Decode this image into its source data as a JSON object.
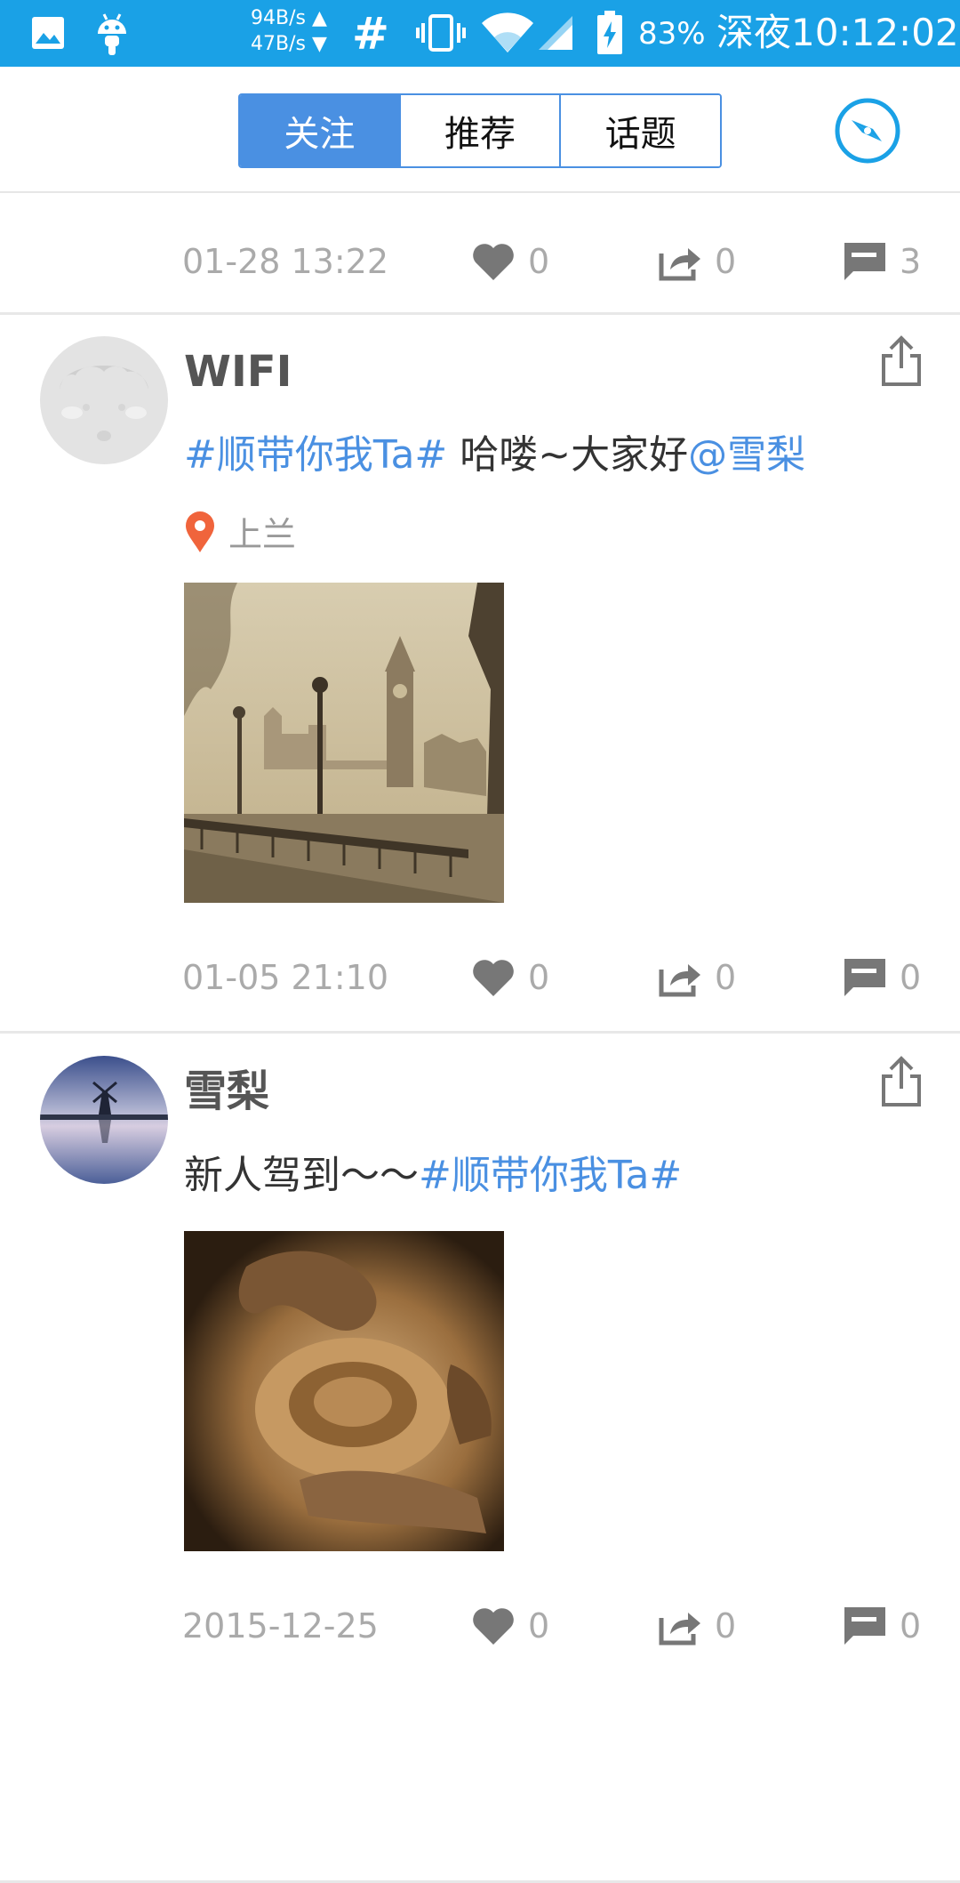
{
  "status_bar": {
    "net_down": "94B/s",
    "net_up": "47B/s",
    "hash": "#",
    "battery": "83%",
    "time": "深夜10:12:02"
  },
  "header": {
    "tabs": [
      "关注",
      "推荐",
      "话题"
    ],
    "active_tab": "关注",
    "accent": "#4a90e2"
  },
  "top_footer": {
    "date": "01-28 13:22",
    "likes": "0",
    "shares": "0",
    "comments": "3"
  },
  "posts": [
    {
      "username": "WIFI",
      "content_tag": "#顺带你我Ta#",
      "content_text": " 哈喽~大家好",
      "content_mention": "@雪梨",
      "location": "上兰",
      "date": "01-05 21:10",
      "likes": "0",
      "shares": "0",
      "comments": "0"
    },
    {
      "username": "雪梨",
      "content_text": "新人驾到～～",
      "content_tag": "#顺带你我Ta#",
      "date": "2015-12-25",
      "likes": "0",
      "shares": "0",
      "comments": "0"
    }
  ]
}
